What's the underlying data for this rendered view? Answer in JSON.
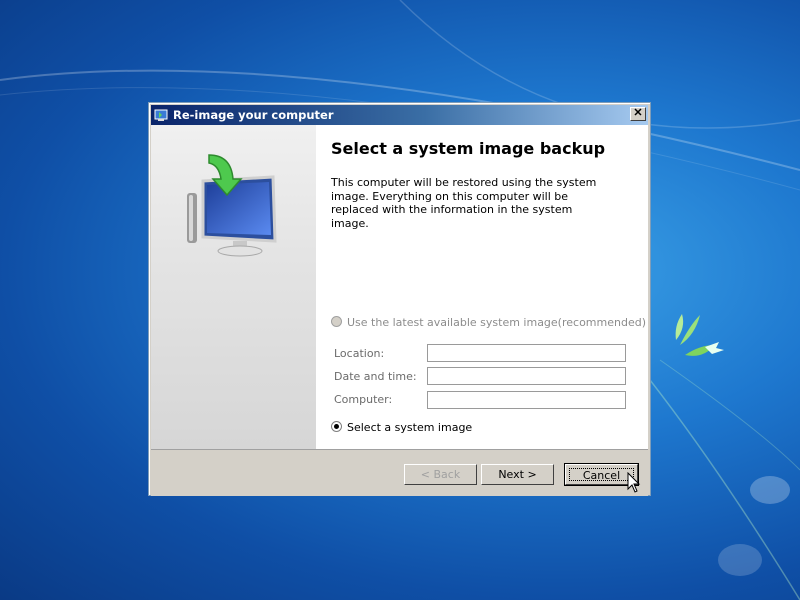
{
  "dialog": {
    "title": "Re-image your computer",
    "close_label": "✕",
    "heading": "Select a system image backup",
    "description": "This computer will be restored using the system image. Everything on this computer will be replaced with the information in the system image.",
    "option_latest": "Use the latest available system image(recommended)",
    "option_select": "Select a system image",
    "fields": {
      "location_label": "Location:",
      "datetime_label": "Date and time:",
      "computer_label": "Computer:",
      "location_value": "",
      "datetime_value": "",
      "computer_value": ""
    },
    "buttons": {
      "back": "< Back",
      "next": "Next >",
      "cancel": "Cancel"
    }
  },
  "colors": {
    "desktop_blue": "#1e78cf",
    "dialog_face": "#d4d0c8",
    "titlebar_start": "#0a246a"
  },
  "icons": {
    "title": "restore-icon",
    "hero": "monitor-restore-icon",
    "cursor": "mouse-pointer-icon"
  }
}
